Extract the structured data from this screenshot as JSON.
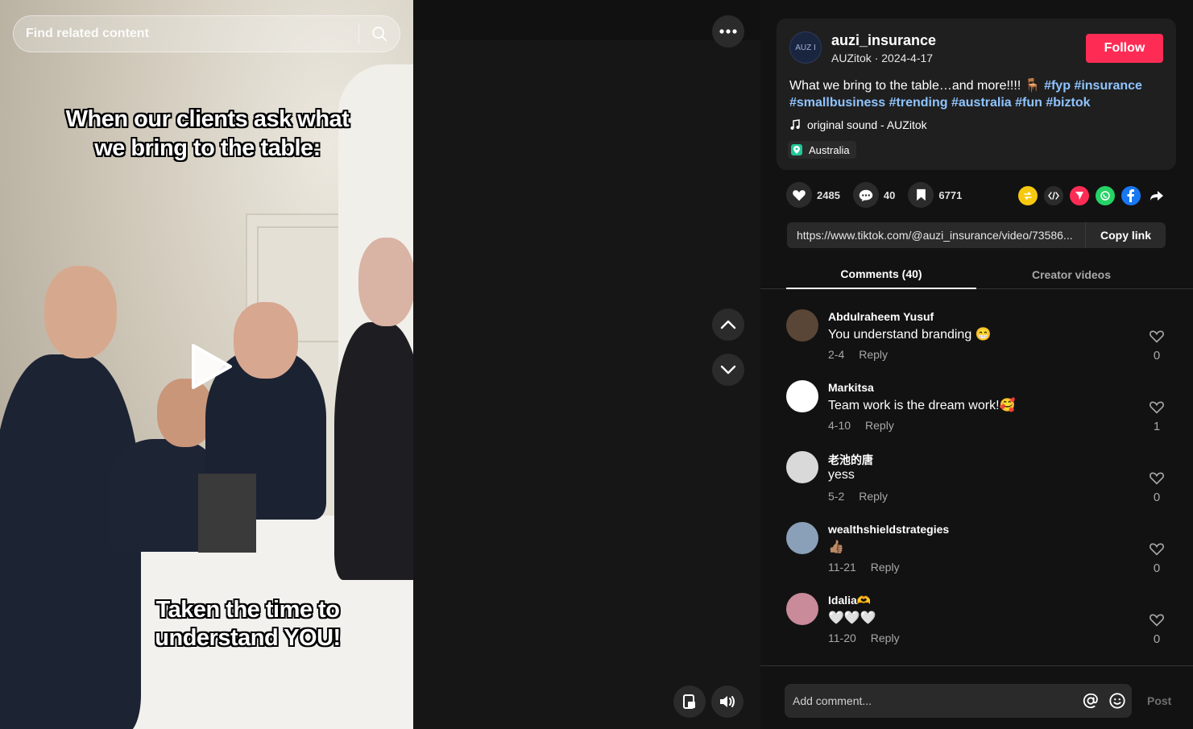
{
  "search": {
    "placeholder": "Find related content"
  },
  "video": {
    "caption_top": "When our clients ask what we bring to the table:",
    "caption_bottom": "Taken the time to understand YOU!"
  },
  "author": {
    "username": "auzi_insurance",
    "display_name": "AUZitok",
    "date": "2024-4-17",
    "avatar_text": "AUZ I",
    "follow_label": "Follow"
  },
  "description": {
    "text": "What we bring to the table…and more!!!! 🪑",
    "tags": [
      "#fyp",
      "#insurance",
      "#smallbusiness",
      "#trending",
      "#australia",
      "#fun",
      "#biztok"
    ]
  },
  "sound": "original sound - AUZitok",
  "location": "Australia",
  "stats": {
    "likes": "2485",
    "comments": "40",
    "saves": "6771"
  },
  "share_icons": [
    "repost-icon",
    "embed-icon",
    "send-icon",
    "whatsapp-icon",
    "facebook-icon",
    "share-arrow-icon"
  ],
  "link": {
    "url": "https://www.tiktok.com/@auzi_insurance/video/73586...",
    "copy_label": "Copy link"
  },
  "tabs": [
    "Comments (40)",
    "Creator videos"
  ],
  "comments": [
    {
      "name": "Abdulraheem Yusuf",
      "text": "You understand branding 😁",
      "date": "2-4",
      "reply": "Reply",
      "likes": "0",
      "avatar_color": "#5a4636"
    },
    {
      "name": "Markitsa",
      "text": "Team work is the dream work!🥰",
      "date": "4-10",
      "reply": "Reply",
      "likes": "1",
      "avatar_color": "#ffffff"
    },
    {
      "name": "老池的唐",
      "text": "yess",
      "date": "5-2",
      "reply": "Reply",
      "likes": "0",
      "avatar_color": "#d9d9d9"
    },
    {
      "name": "wealthshieldstrategies",
      "text": "👍🏽",
      "date": "11-21",
      "reply": "Reply",
      "likes": "0",
      "avatar_color": "#8aa0b8"
    },
    {
      "name": "Idalia🫶",
      "text": "🤍🤍🤍",
      "date": "11-20",
      "reply": "Reply",
      "likes": "0",
      "avatar_color": "#c98a9a"
    }
  ],
  "comment_input": {
    "placeholder": "Add comment...",
    "post_label": "Post"
  },
  "colors": {
    "accent": "#fe2c55",
    "hashtag": "#8fc4ff",
    "panel": "#1f1f1f"
  }
}
